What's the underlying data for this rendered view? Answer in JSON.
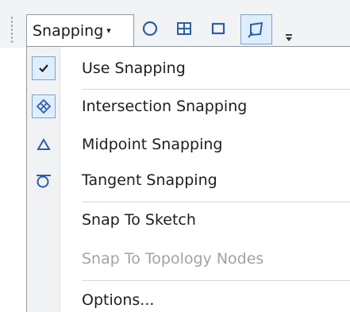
{
  "toolbar": {
    "dropdown_label": "Snapping",
    "caret": "▾",
    "buttons": [
      {
        "icon": "point-snapping-icon",
        "active": false
      },
      {
        "icon": "vertex-snapping-icon",
        "active": false
      },
      {
        "icon": "edge-snapping-icon",
        "active": false
      },
      {
        "icon": "end-snapping-icon",
        "active": true
      }
    ],
    "overflow_icon": "toolbar-overflow-icon"
  },
  "menu": {
    "items": [
      {
        "label": "Use Snapping",
        "icon": "checkmark-icon",
        "checked": true,
        "enabled": true
      },
      {
        "label": "Intersection Snapping",
        "icon": "intersection-snapping-icon",
        "checked": true,
        "enabled": true
      },
      {
        "label": "Midpoint Snapping",
        "icon": "midpoint-snapping-icon",
        "checked": false,
        "enabled": true
      },
      {
        "label": "Tangent Snapping",
        "icon": "tangent-snapping-icon",
        "checked": false,
        "enabled": true
      },
      {
        "label": "Snap To Sketch",
        "icon": "",
        "checked": false,
        "enabled": true
      },
      {
        "label": "Snap To Topology Nodes",
        "icon": "",
        "checked": false,
        "enabled": false
      },
      {
        "label": "Options...",
        "icon": "",
        "checked": false,
        "enabled": true
      }
    ]
  },
  "colors": {
    "accent_fill": "#dfeefb",
    "accent_border": "#7da2ce",
    "icon_blue": "#2a5fa8",
    "disabled_text": "#a3a3a3"
  }
}
